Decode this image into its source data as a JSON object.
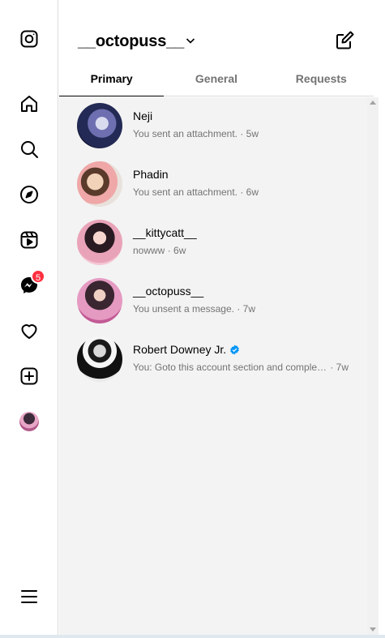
{
  "header": {
    "username": "__octopuss__"
  },
  "tabs": [
    {
      "label": "Primary"
    },
    {
      "label": "General"
    },
    {
      "label": "Requests"
    }
  ],
  "rail": {
    "messages_badge": "5"
  },
  "conversations": [
    {
      "name": "Neji",
      "message": "You sent an attachment.",
      "sep": " · ",
      "time": "5w",
      "verified": false
    },
    {
      "name": "Phadin",
      "message": "You sent an attachment.",
      "sep": " · ",
      "time": "6w",
      "verified": false
    },
    {
      "name": "__kittycatt__",
      "message": "nowww",
      "sep": " · ",
      "time": "6w",
      "verified": false
    },
    {
      "name": "__octopuss__",
      "message": "You unsent a message.",
      "sep": " · ",
      "time": "7w",
      "verified": false
    },
    {
      "name": "Robert Downey Jr.",
      "message": "You: Goto this account section and complet...",
      "sep": " · ",
      "time": "7w",
      "verified": true
    }
  ],
  "colors": {
    "badge": "#ff3040",
    "verified": "#0095f6",
    "list_bg": "#f3f3f3"
  }
}
